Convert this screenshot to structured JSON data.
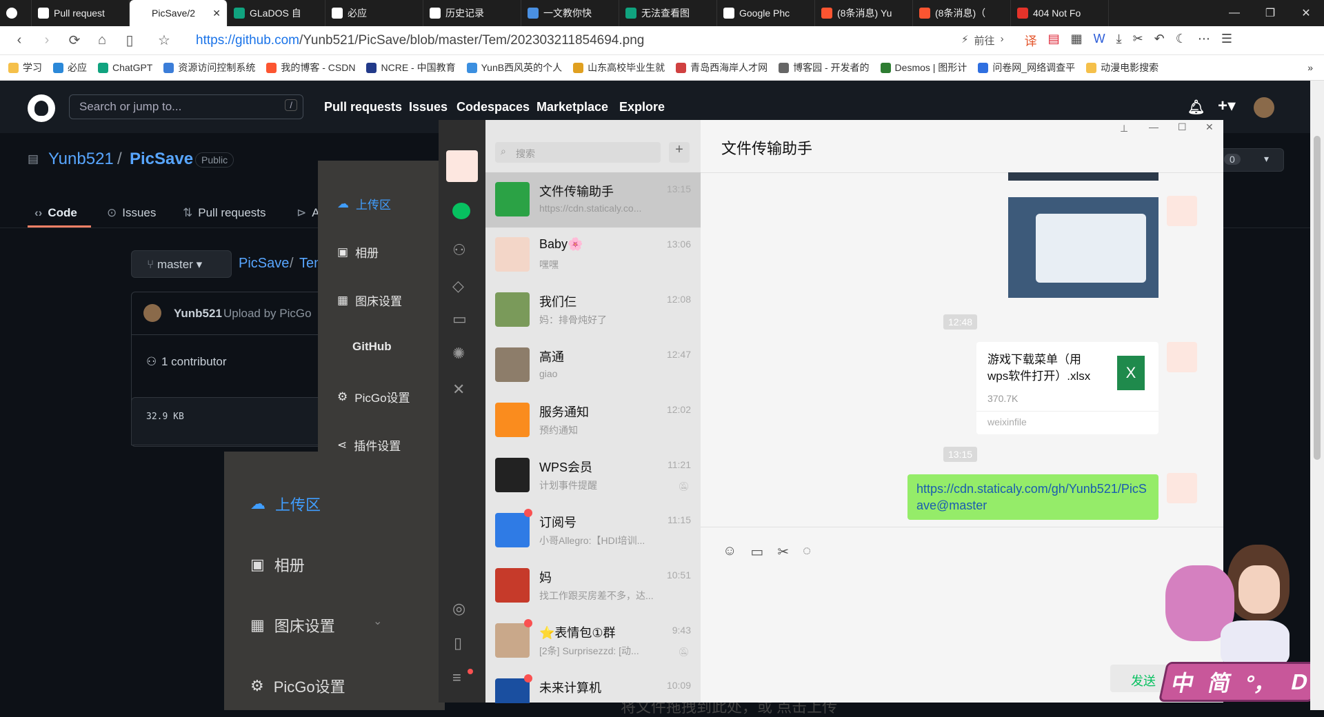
{
  "browser": {
    "tabs": [
      {
        "label": "",
        "icon": "browser-logo-icon",
        "color": "#fff"
      },
      {
        "label": "Pull request",
        "icon": "github-icon",
        "color": "#fff"
      },
      {
        "label": "PicSave/2",
        "icon": "",
        "color": "#fff",
        "active": true
      },
      {
        "label": "GLaDOS 自",
        "icon": "openai-icon",
        "color": "#10a37f"
      },
      {
        "label": "必应",
        "icon": "search-icon",
        "color": "#fff"
      },
      {
        "label": "历史记录",
        "icon": "history-icon",
        "color": "#fff"
      },
      {
        "label": "一文教你快",
        "icon": "cloud-icon",
        "color": "#4a90e2"
      },
      {
        "label": "无法查看图",
        "icon": "openai-icon",
        "color": "#10a37f"
      },
      {
        "label": "Google Phc",
        "icon": "search-icon",
        "color": "#fff"
      },
      {
        "label": "(8条消息) Yu",
        "icon": "csdn-icon",
        "color": "#fc5531"
      },
      {
        "label": "(8条消息)（",
        "icon": "csdn-icon",
        "color": "#fc5531"
      },
      {
        "label": "404 Not Fo",
        "icon": "fire-icon",
        "color": "#e4332a"
      }
    ],
    "url_host": "https://github.com",
    "url_path": "/Yunb521/PicSave/blob/master/Tem/202303211854694.png",
    "goto_label": "前往",
    "bookmarks": [
      {
        "label": "学习",
        "color": "#f5c04a"
      },
      {
        "label": "必应",
        "color": "#2b88d8"
      },
      {
        "label": "ChatGPT",
        "color": "#10a37f"
      },
      {
        "label": "资源访问控制系统",
        "color": "#3b7dd8"
      },
      {
        "label": "我的博客 - CSDN",
        "color": "#fc5531"
      },
      {
        "label": "NCRE - 中国教育",
        "color": "#223a8a"
      },
      {
        "label": "YunB西风英的个人",
        "color": "#3b8fe0"
      },
      {
        "label": "山东高校毕业生就",
        "color": "#e0a020"
      },
      {
        "label": "青岛西海岸人才网",
        "color": "#d04040"
      },
      {
        "label": "博客园 - 开发者的",
        "color": "#666666"
      },
      {
        "label": "Desmos | 图形计",
        "color": "#2e7d32"
      },
      {
        "label": "问卷网_网络调查平",
        "color": "#2f6fe0"
      },
      {
        "label": "动漫电影搜索",
        "color": "#f5c04a"
      }
    ],
    "more_bookmarks": "»"
  },
  "github": {
    "search_placeholder": "Search or jump to...",
    "search_key": "/",
    "nav": [
      "Pull requests",
      "Issues",
      "Codespaces",
      "Marketplace",
      "Explore"
    ],
    "owner": "Yunb521",
    "sep": "/",
    "repo": "PicSave",
    "visibility": "Public",
    "tabs": [
      "Code",
      "Issues",
      "Pull requests",
      "A"
    ],
    "branch": "master",
    "crumb_repo": "PicSave",
    "crumb_tem": "Ten",
    "commit_user": "Yunb521",
    "commit_msg": "Upload by PicGo",
    "contributors": "1 contributor",
    "file_size": "32.9 KB",
    "counter": "0",
    "drop_text": "将文件拖拽到此处，或 点击上传"
  },
  "picgo": {
    "menu": [
      {
        "label": "上传区",
        "icon": "cloud-upload-icon",
        "active": true
      },
      {
        "label": "相册",
        "icon": "image-icon"
      },
      {
        "label": "图床设置",
        "icon": "grid-icon"
      },
      {
        "label": "GitHub",
        "icon": ""
      },
      {
        "label": "PicGo设置",
        "icon": "gear-icon"
      },
      {
        "label": "插件设置",
        "icon": "share-icon"
      }
    ],
    "menu2": [
      "上传区",
      "相册",
      "图床设置",
      "PicGo设置"
    ]
  },
  "wechat": {
    "search_placeholder": "搜索",
    "conversations": [
      {
        "name": "文件传输助手",
        "preview": "https://cdn.staticaly.co...",
        "time": "13:15",
        "avatar": "#2ba245",
        "selected": true
      },
      {
        "name": "Baby🌸",
        "preview": "嘿嘿",
        "time": "13:06",
        "avatar": "#f3d6c8"
      },
      {
        "name": "我们仨",
        "preview": "妈：排骨炖好了",
        "time": "12:08",
        "avatar": "#7a9a5a"
      },
      {
        "name": "高通",
        "preview": "giao",
        "time": "12:47",
        "avatar": "#8d7d6a"
      },
      {
        "name": "服务通知",
        "preview": "预约通知",
        "time": "12:02",
        "avatar": "#fa8c1e"
      },
      {
        "name": "WPS会员",
        "preview": "计划事件提醒",
        "time": "11:21",
        "avatar": "#222222",
        "muted": true
      },
      {
        "name": "订阅号",
        "preview": "小哥Allegro:【HDI培训...",
        "time": "11:15",
        "avatar": "#2f7be5",
        "dot": true
      },
      {
        "name": "妈",
        "preview": "找工作跟买房差不多，达...",
        "time": "10:51",
        "avatar": "#c63a2a"
      },
      {
        "name": "⭐表情包①群",
        "preview": "[2条] Surprisezzd: [动...",
        "time": "9:43",
        "avatar": "#c9a88a",
        "dot": true,
        "muted": true
      },
      {
        "name": "未来计算机",
        "preview": "",
        "time": "10:09",
        "avatar": "#1a4fa0",
        "dot": true
      }
    ],
    "chat_title": "文件传输助手",
    "ts1": "12:48",
    "file_name": "游戏下载菜单（用wps软件打开）.xlsx",
    "file_size": "370.7K",
    "file_src": "weixinfile",
    "file_icon": "X",
    "ts2": "13:15",
    "link_msg": "https://cdn.staticaly.com/gh/Yunb521/PicSave@master",
    "send_label": "发送"
  },
  "ime": {
    "chars": [
      "中",
      "简",
      "°，",
      "D"
    ]
  }
}
